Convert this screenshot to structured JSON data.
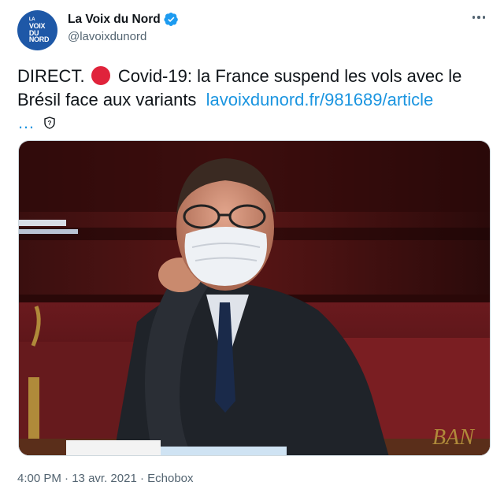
{
  "account": {
    "display_name": "La Voix du Nord",
    "handle": "@lavoixdunord",
    "avatar_text": [
      "LA",
      "VOIX",
      "DU",
      "NORD"
    ],
    "verified": true
  },
  "tweet": {
    "text_part1": "DIRECT.",
    "text_part2": "Covid-19: la France suspend les vols avec le Brésil face aux variants",
    "link": "lavoixdunord.fr/981689/article",
    "ellipsis": "…"
  },
  "media": {
    "watermark": "BAN"
  },
  "footer": {
    "time": "4:00 PM",
    "date": "13 avr. 2021",
    "source": "Echobox",
    "separator": "·"
  },
  "colors": {
    "brand": "#1e58a7",
    "link": "#1b95e0",
    "red_dot": "#e0233b",
    "muted": "#536471"
  },
  "icons": [
    "verified-icon",
    "more-icon",
    "red-circle-icon",
    "shield-icon"
  ]
}
